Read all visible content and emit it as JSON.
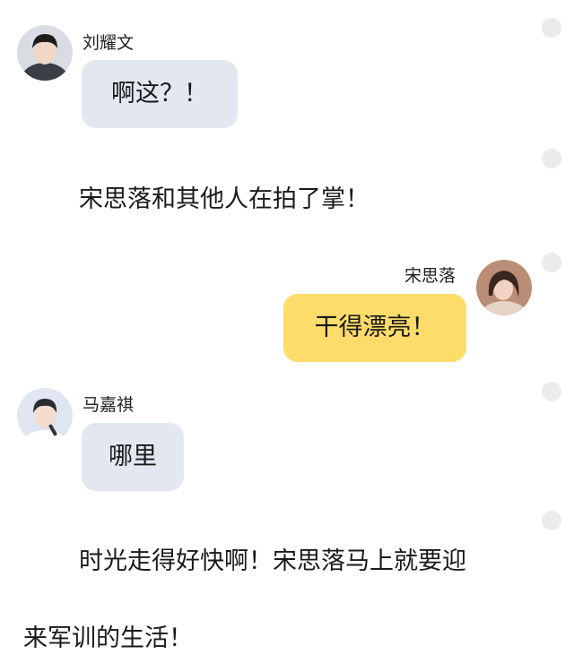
{
  "messages": [
    {
      "type": "chat",
      "side": "left",
      "name": "刘耀文",
      "text": "啊这？！",
      "bubble_color": "#e3e8f0",
      "avatar": "avatar-liu-yaowen"
    },
    {
      "type": "narration",
      "text": "宋思落和其他人在拍了掌！"
    },
    {
      "type": "chat",
      "side": "right",
      "name": "宋思落",
      "text": "干得漂亮！",
      "bubble_color": "#fddc6a",
      "avatar": "avatar-song-siluo"
    },
    {
      "type": "chat",
      "side": "left",
      "name": "马嘉祺",
      "text": "哪里",
      "bubble_color": "#e3e8f0",
      "avatar": "avatar-ma-jiaqi"
    },
    {
      "type": "narration",
      "text_line1": "时光走得好快啊！宋思落马上就要迎",
      "text_line2": "来军训的生活！"
    }
  ],
  "colors": {
    "background": "#ffffff",
    "grey_bubble": "#e3e8f0",
    "yellow_bubble": "#fddc6a",
    "side_dot": "#ebebeb"
  }
}
